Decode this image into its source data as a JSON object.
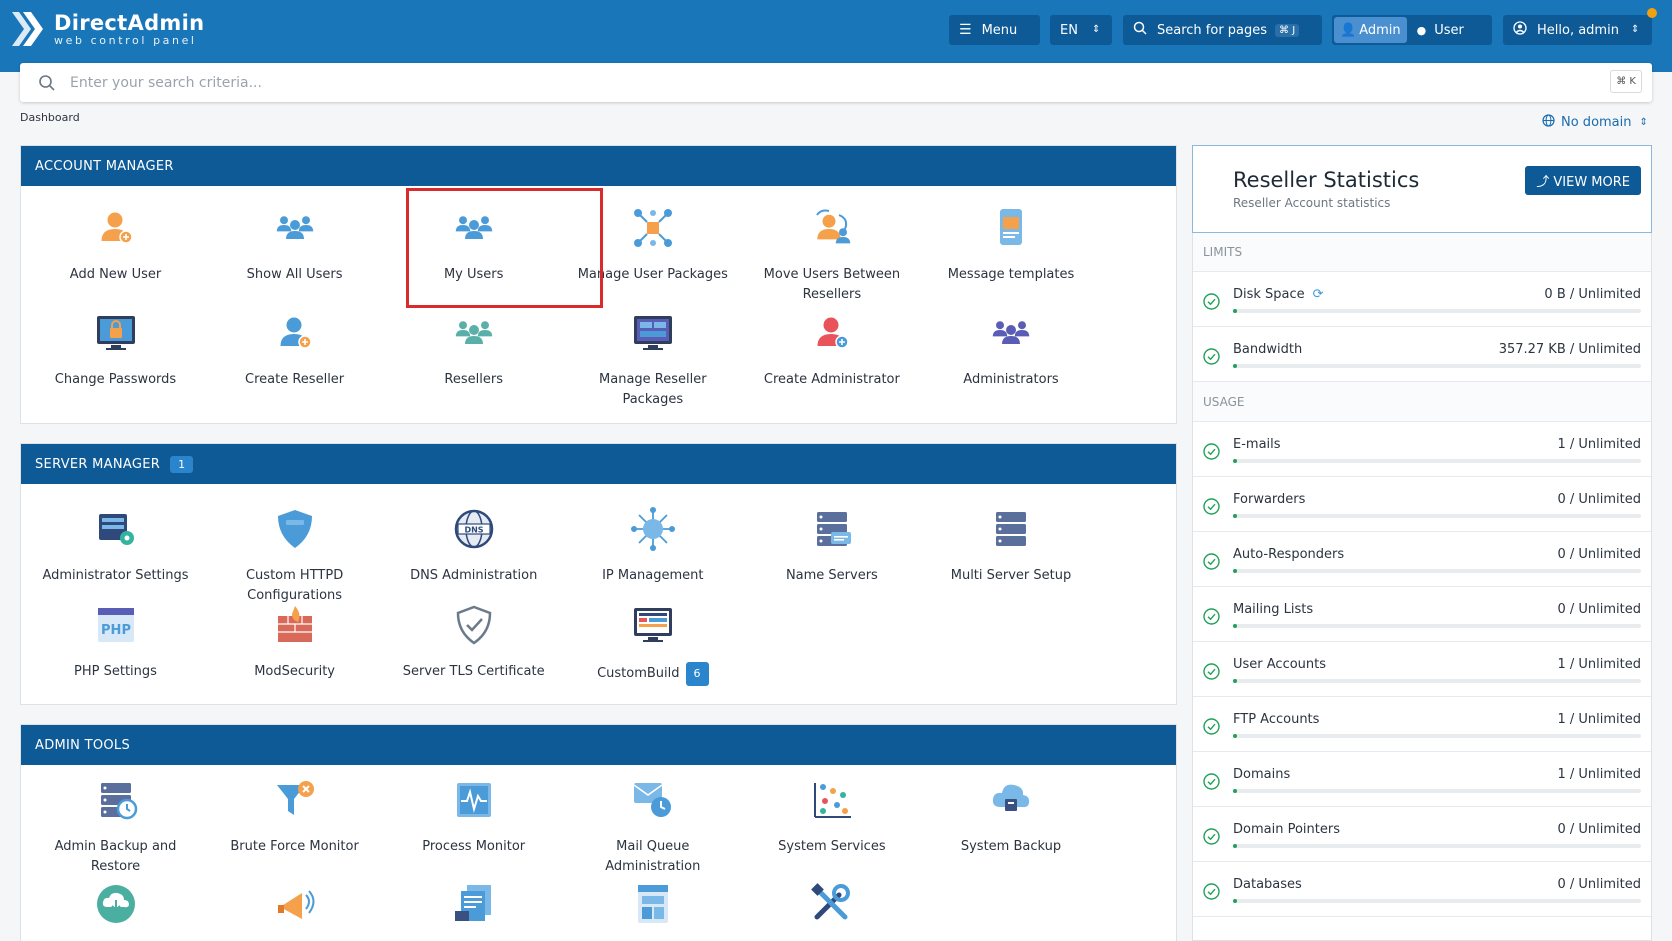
{
  "brand": {
    "title": "DirectAdmin",
    "subtitle": "web control panel"
  },
  "topbar": {
    "menu_label": "Menu",
    "lang_label": "EN",
    "search_pages_label": "Search for pages",
    "search_pages_kbd": "⌘ J",
    "role_admin": "Admin",
    "role_user": "User",
    "hello_label": "Hello, admin"
  },
  "search": {
    "placeholder": "Enter your search criteria...",
    "kbd": "⌘ K"
  },
  "breadcrumb": "Dashboard",
  "domain_selector": "No domain",
  "account_manager": {
    "title": "ACCOUNT MANAGER",
    "tiles": [
      {
        "label": "Add New User",
        "icon": "add-user-icon"
      },
      {
        "label": "Show All Users",
        "icon": "users-group-icon"
      },
      {
        "label": "My Users",
        "icon": "my-users-icon"
      },
      {
        "label": "Manage User Packages",
        "icon": "packages-network-icon"
      },
      {
        "label": "Move Users Between Resellers",
        "icon": "move-users-icon"
      },
      {
        "label": "Message templates",
        "icon": "message-template-icon"
      },
      {
        "label": "Change Passwords",
        "icon": "lock-monitor-icon"
      },
      {
        "label": "Create Reseller",
        "icon": "create-reseller-icon"
      },
      {
        "label": "Resellers",
        "icon": "resellers-group-icon"
      },
      {
        "label": "Manage Reseller Packages",
        "icon": "reseller-packages-icon"
      },
      {
        "label": "Create Administrator",
        "icon": "create-admin-icon"
      },
      {
        "label": "Administrators",
        "icon": "administrators-group-icon"
      }
    ]
  },
  "server_manager": {
    "title": "SERVER MANAGER",
    "badge": "1",
    "tiles": [
      {
        "label": "Administrator Settings",
        "icon": "admin-settings-icon"
      },
      {
        "label": "Custom HTTPD Configurations",
        "icon": "httpd-shield-icon"
      },
      {
        "label": "DNS Administration",
        "icon": "dns-globe-icon"
      },
      {
        "label": "IP Management",
        "icon": "ip-network-icon"
      },
      {
        "label": "Name Servers",
        "icon": "name-servers-icon"
      },
      {
        "label": "Multi Server Setup",
        "icon": "server-stack-icon"
      },
      {
        "label": "PHP Settings",
        "icon": "php-icon"
      },
      {
        "label": "ModSecurity",
        "icon": "firewall-icon"
      },
      {
        "label": "Server TLS Certificate",
        "icon": "tls-shield-icon"
      },
      {
        "label": "CustomBuild",
        "icon": "custombuild-monitor-icon",
        "badge": "6"
      }
    ]
  },
  "admin_tools": {
    "title": "ADMIN TOOLS",
    "tiles": [
      {
        "label": "Admin Backup and Restore",
        "icon": "backup-restore-icon"
      },
      {
        "label": "Brute Force Monitor",
        "icon": "brute-force-funnel-icon"
      },
      {
        "label": "Process Monitor",
        "icon": "process-monitor-icon"
      },
      {
        "label": "Mail Queue Administration",
        "icon": "mail-queue-icon"
      },
      {
        "label": "System Services",
        "icon": "system-services-icon"
      },
      {
        "label": "System Backup",
        "icon": "cloud-backup-icon"
      },
      {
        "label": "",
        "icon": "cloud-download-icon"
      },
      {
        "label": "",
        "icon": "megaphone-icon"
      },
      {
        "label": "",
        "icon": "log-files-icon"
      },
      {
        "label": "",
        "icon": "layout-window-icon"
      },
      {
        "label": "",
        "icon": "tools-icon"
      }
    ]
  },
  "reseller_stats": {
    "title": "Reseller Statistics",
    "subtitle": "Reseller Account statistics",
    "view_more": "VIEW MORE",
    "limits_label": "LIMITS",
    "usage_label": "USAGE",
    "limits": [
      {
        "name": "Disk Space",
        "value": "0 B / Unlimited",
        "fill": 0.005
      },
      {
        "name": "Bandwidth",
        "value": "357.27 KB / Unlimited",
        "fill": 0.005
      }
    ],
    "usage": [
      {
        "name": "E-mails",
        "value": "1 / Unlimited",
        "fill": 0.005
      },
      {
        "name": "Forwarders",
        "value": "0 / Unlimited",
        "fill": 0.005
      },
      {
        "name": "Auto-Responders",
        "value": "0 / Unlimited",
        "fill": 0.005
      },
      {
        "name": "Mailing Lists",
        "value": "0 / Unlimited",
        "fill": 0.005
      },
      {
        "name": "User Accounts",
        "value": "1 / Unlimited",
        "fill": 0.005
      },
      {
        "name": "FTP Accounts",
        "value": "1 / Unlimited",
        "fill": 0.005
      },
      {
        "name": "Domains",
        "value": "1 / Unlimited",
        "fill": 0.005
      },
      {
        "name": "Domain Pointers",
        "value": "0 / Unlimited",
        "fill": 0.005
      },
      {
        "name": "Databases",
        "value": "0 / Unlimited",
        "fill": 0.005
      }
    ]
  },
  "colors": {
    "topbar": "#1976b8",
    "panel_head": "#0d5a96",
    "accent": "#2a85cc",
    "ok": "#22a05a",
    "highlight": "#d92b2b"
  }
}
